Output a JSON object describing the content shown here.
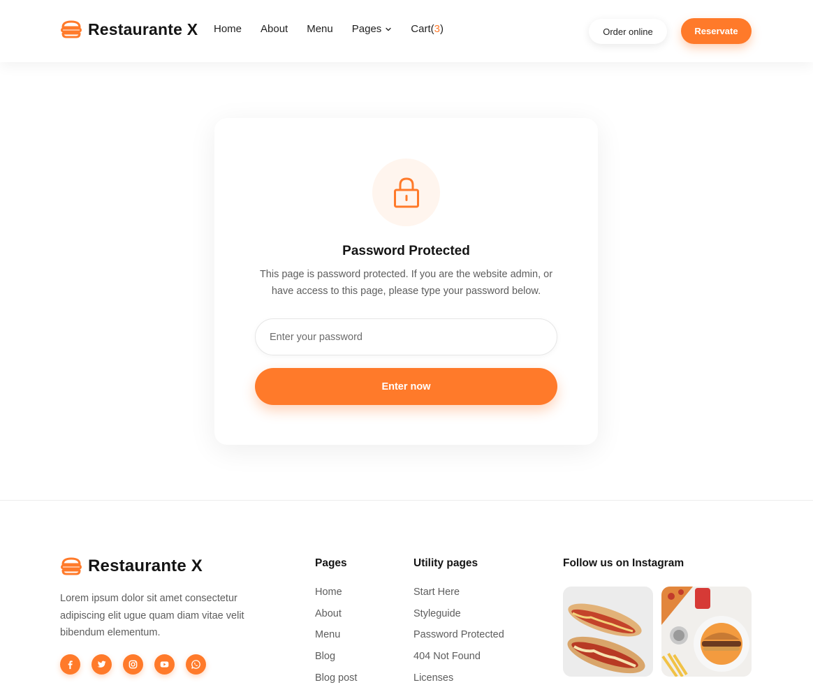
{
  "header": {
    "brand": "Restaurante X",
    "nav": {
      "home": "Home",
      "about": "About",
      "menu": "Menu",
      "pages": "Pages",
      "cart_label": "Cart(",
      "cart_count": "3",
      "cart_close": ")"
    },
    "order_online": "Order online",
    "reservate": "Reservate"
  },
  "card": {
    "icon": "lock-icon",
    "title": "Password Protected",
    "description": "This page is password protected. If you are the website admin, or have access to this page, please type your password below.",
    "password_placeholder": "Enter your password",
    "password_value": "",
    "submit_label": "Enter now"
  },
  "footer": {
    "brand": "Restaurante X",
    "description": "Lorem ipsum dolor sit amet consectetur adipiscing elit ugue quam diam vitae velit bibendum elementum.",
    "socials": [
      "facebook-icon",
      "twitter-icon",
      "instagram-icon",
      "youtube-icon",
      "whatsapp-icon"
    ],
    "pages": {
      "title": "Pages",
      "links": [
        "Home",
        "About",
        "Menu",
        "Blog",
        "Blog post"
      ]
    },
    "utility": {
      "title": "Utility pages",
      "links": [
        "Start Here",
        "Styleguide",
        "Password Protected",
        "404 Not Found",
        "Licenses"
      ]
    },
    "instagram": {
      "title": "Follow us on Instagram",
      "images": [
        "hot-dog-photo",
        "burger-and-pizza-photo"
      ]
    }
  },
  "colors": {
    "accent": "#ff7a2a",
    "accent_soft": "#fff5ee",
    "text_dark": "#141414",
    "text_muted": "#5d5d5d"
  }
}
